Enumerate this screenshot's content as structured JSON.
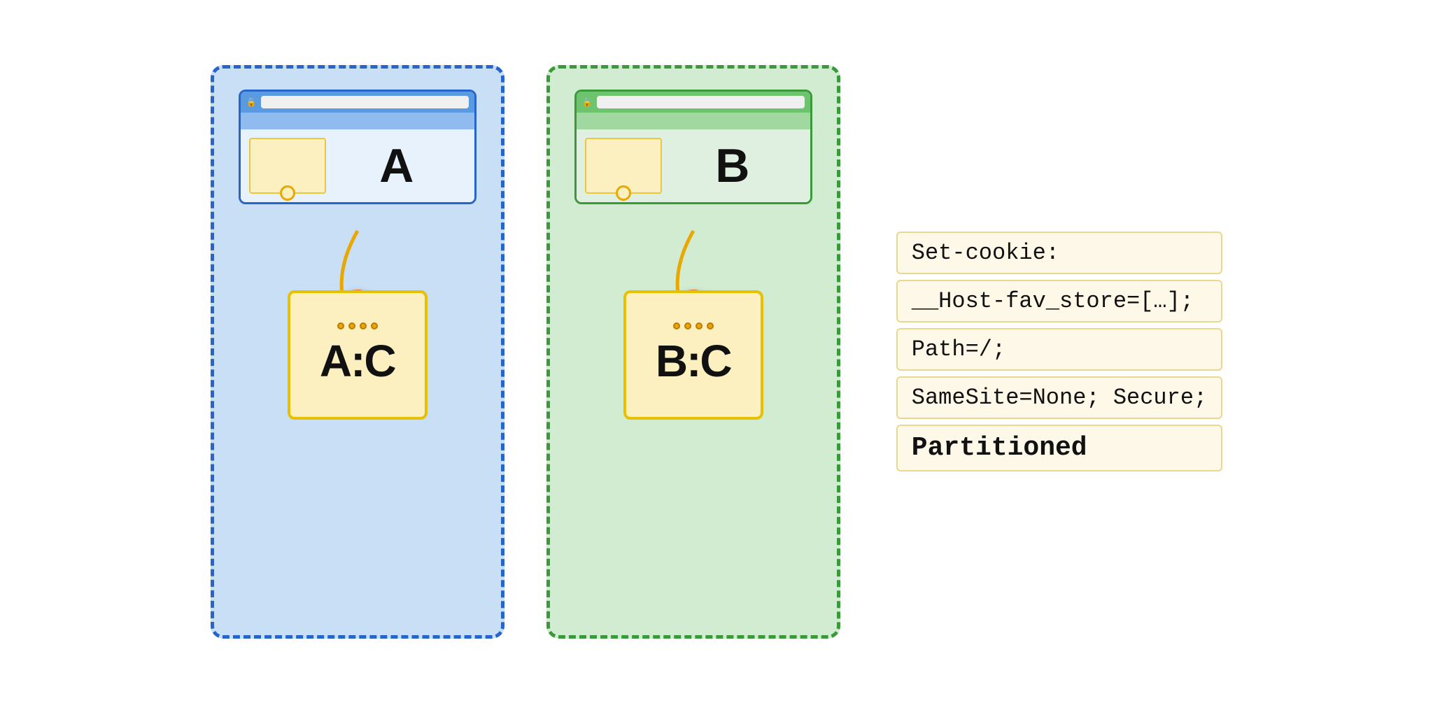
{
  "diagram": {
    "partition_a": {
      "border_style": "dashed",
      "border_color": "#2666cc",
      "bg_color": "#c9dff5",
      "browser": {
        "titlebar_color": "#5a9ae0",
        "toolbar_color": "#90bbee",
        "content_color": "#e8f2fc",
        "border_color": "#2666cc",
        "label": "A",
        "lock_icon": "🔒"
      },
      "cookie_emoji": "🍪",
      "storage_label": "A:C",
      "storage_dots": 4
    },
    "partition_b": {
      "border_style": "dashed",
      "border_color": "#3a9a3a",
      "bg_color": "#d2ecd2",
      "browser": {
        "titlebar_color": "#6ec46e",
        "toolbar_color": "#a0d8a0",
        "content_color": "#e0f0e0",
        "border_color": "#3a9a3a",
        "label": "B",
        "lock_icon": "🔒"
      },
      "cookie_emoji": "🍪",
      "storage_label": "B:C",
      "storage_dots": 4
    },
    "code_lines": [
      "Set-cookie:",
      "__Host-fav_store=[…];",
      "Path=/;",
      "SameSite=None; Secure;",
      "Partitioned"
    ]
  }
}
